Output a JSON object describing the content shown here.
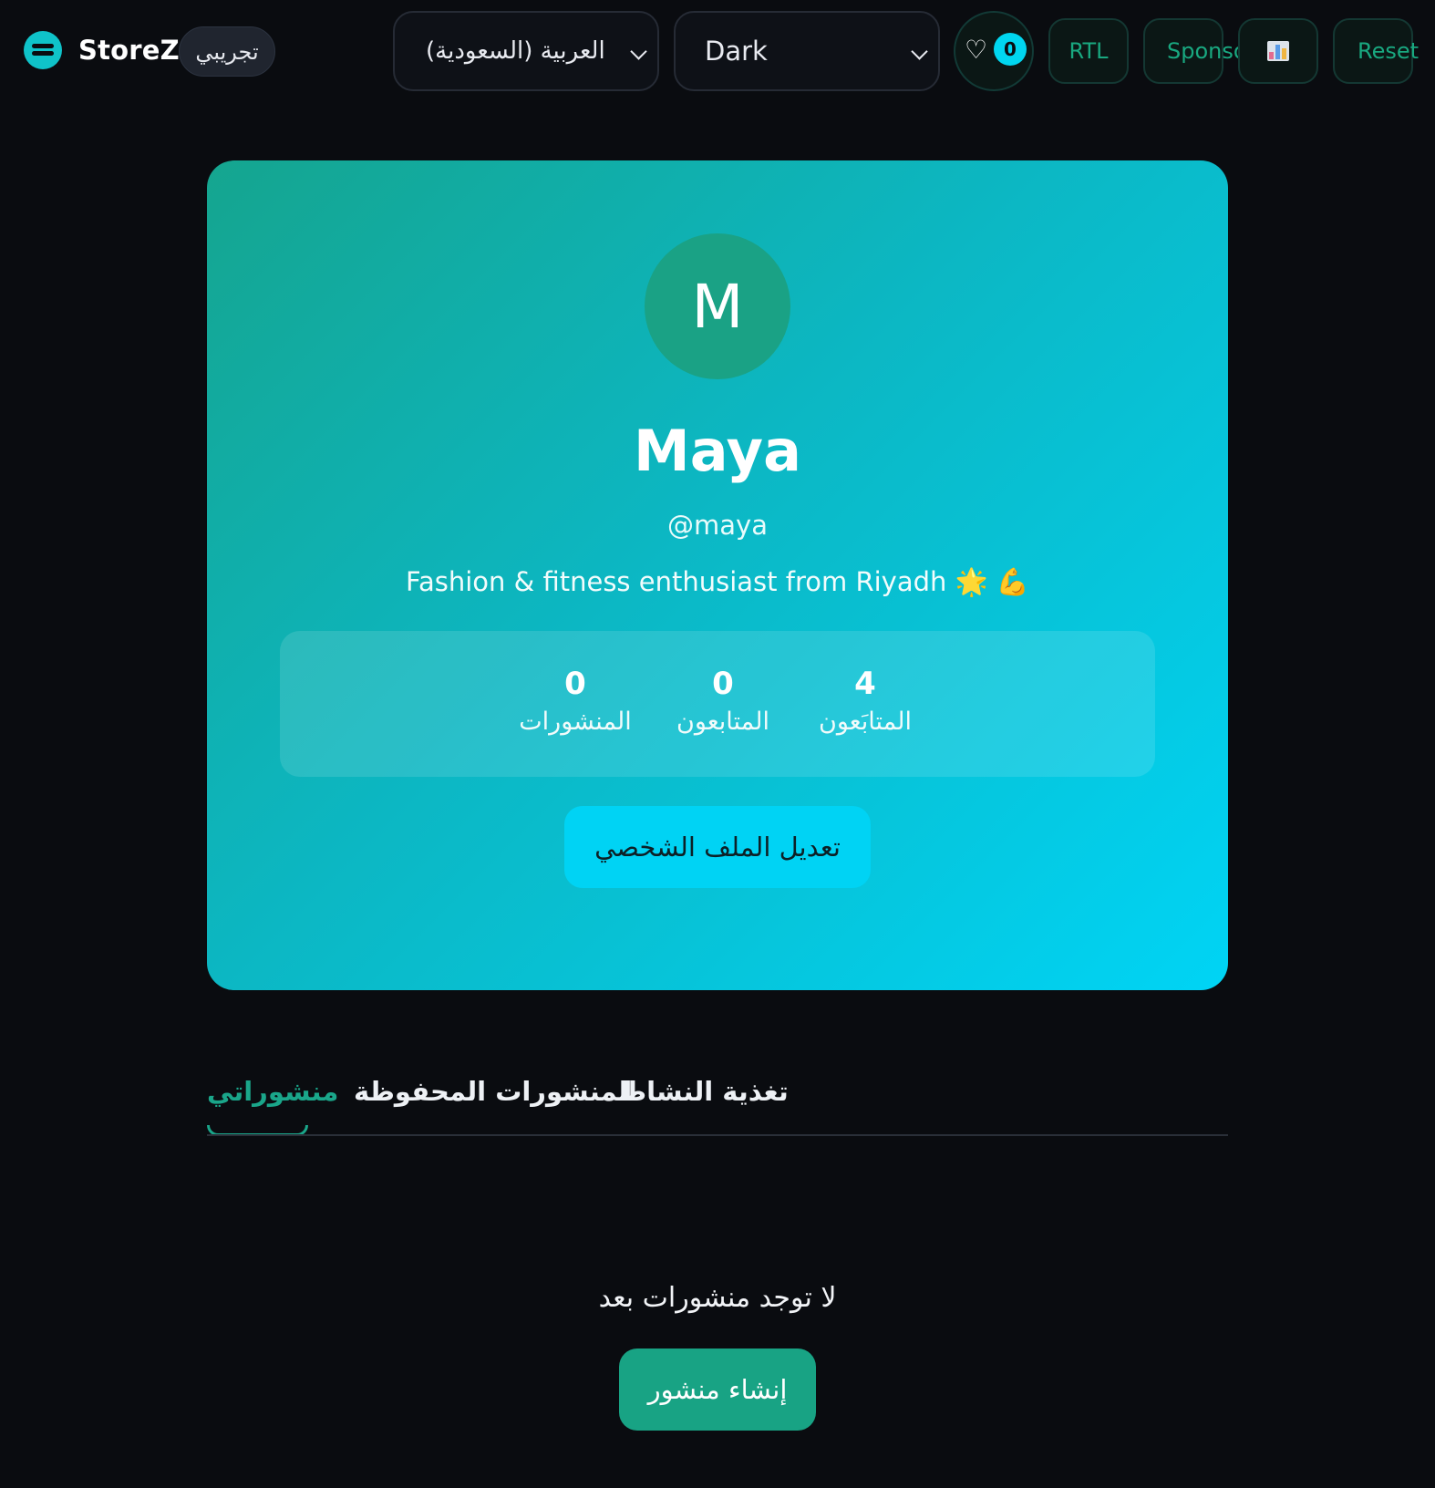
{
  "header": {
    "brand_name": "StoreZ",
    "beta_badge": "تجريبي",
    "language_select": {
      "selected": "العربية (السعودية)"
    },
    "theme_select": {
      "selected": "Dark"
    },
    "favorites": {
      "icon": "heart-icon",
      "count": "0"
    },
    "rtl_label": "RTL",
    "sponsor_label": "Sponsor",
    "stats_icon": "bar-chart-icon",
    "reset_label": "Reset"
  },
  "profile": {
    "avatar_initial": "M",
    "name": "Maya",
    "handle": "@maya",
    "bio": "Fashion & fitness enthusiast from Riyadh 🌟 💪",
    "stats": {
      "posts": {
        "value": "0",
        "label": "المنشورات"
      },
      "following": {
        "value": "0",
        "label": "المتابعون"
      },
      "followers": {
        "value": "4",
        "label": "المتابَعون"
      }
    },
    "edit_button": "تعديل الملف الشخصي"
  },
  "tabs": {
    "activity": "تغذية النشاط",
    "saved": "المنشورات المحفوظة",
    "mine": "منشوراتي",
    "active": "mine"
  },
  "empty_state": {
    "message": "لا توجد منشورات بعد",
    "create_button": "إنشاء منشور"
  },
  "colors": {
    "accent": "#1aa68a",
    "cyan": "#00d3f4",
    "background": "#0a0c10"
  }
}
